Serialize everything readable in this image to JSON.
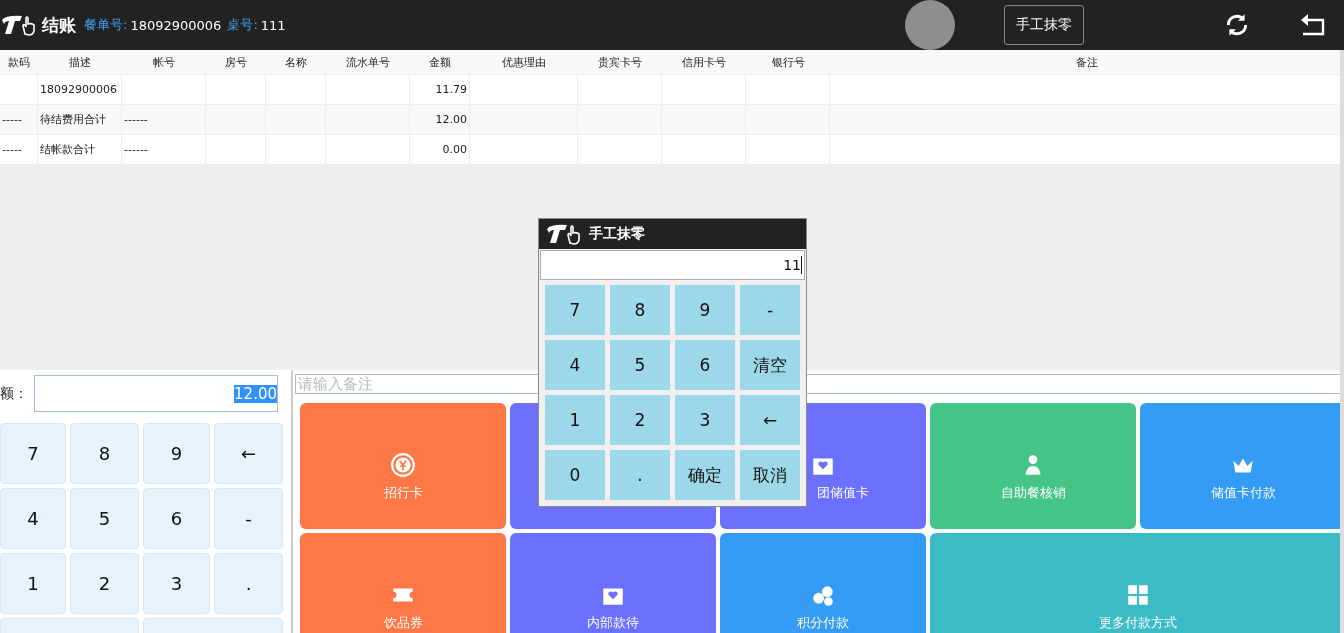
{
  "header": {
    "title": "结账",
    "order_label": "餐单号:",
    "order_no": "18092900006",
    "table_label": "桌号:",
    "table_no": "111",
    "action_button": "手工抹零"
  },
  "table": {
    "columns": [
      "款码",
      "描述",
      "帐号",
      "房号",
      "名称",
      "流水单号",
      "金额",
      "优惠理由",
      "贵宾卡号",
      "信用卡号",
      "银行号",
      "备注"
    ],
    "rows": [
      {
        "cells": [
          null,
          "18092900006",
          null,
          null,
          null,
          null,
          "11.79",
          null,
          null,
          null,
          null,
          null
        ]
      },
      {
        "cells": [
          "-----",
          "待结费用合计",
          "------",
          null,
          null,
          null,
          "12.00",
          null,
          null,
          null,
          null,
          null
        ]
      },
      {
        "cells": [
          "-----",
          "结帐款合计",
          "------",
          null,
          null,
          null,
          "0.00",
          null,
          null,
          null,
          null,
          null
        ]
      }
    ]
  },
  "amount": {
    "label": "额：",
    "value": "12.00",
    "selected": true
  },
  "notes": {
    "placeholder": "请输入备注"
  },
  "keypad": [
    "7",
    "8",
    "9",
    "←",
    "4",
    "5",
    "6",
    "-",
    "1",
    "2",
    "3",
    "."
  ],
  "tiles": [
    {
      "label": "招行卡",
      "color": "#ff7744",
      "kind": "yen",
      "wide": false
    },
    {
      "color": "#6c70ff",
      "wide": false
    },
    {
      "label": "团储值卡",
      "color": "#6c70ff",
      "kind": "heart",
      "wide": false,
      "clipped": true
    },
    {
      "label": "自助餐核销",
      "color": "#44c486",
      "kind": "person",
      "wide": false
    },
    {
      "label": "储值卡付款",
      "color": "#349cf4",
      "kind": "crown",
      "wide": false
    },
    {
      "label": "饮品券",
      "color": "#ff7744",
      "kind": "ticket",
      "wide": false
    },
    {
      "label": "内部款待",
      "color": "#6c70ff",
      "kind": "heart",
      "wide": false
    },
    {
      "label": "积分付款",
      "color": "#349cf4",
      "kind": "coins",
      "wide": false
    },
    {
      "label": "更多付款方式",
      "color": "#3cbac6",
      "kind": "grid",
      "wide": true
    }
  ],
  "dialog": {
    "title": "手工抹零",
    "value": "11",
    "keys": [
      "7",
      "8",
      "9",
      "-",
      "4",
      "5",
      "6",
      "清空",
      "1",
      "2",
      "3",
      "←",
      "0",
      ".",
      "确定",
      "取消"
    ]
  }
}
